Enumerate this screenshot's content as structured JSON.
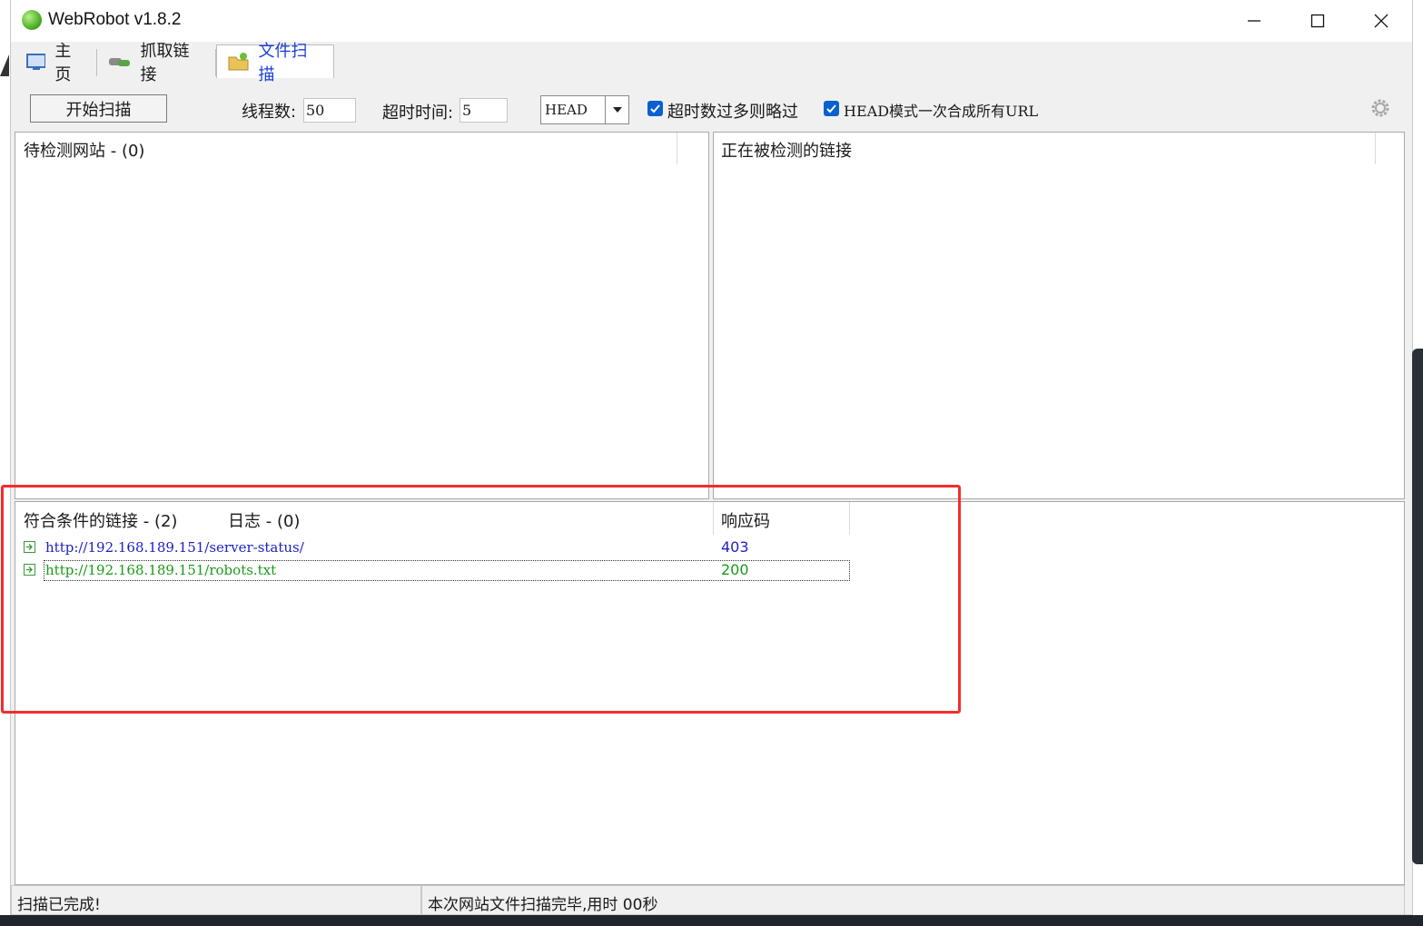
{
  "window": {
    "title": "WebRobot v1.8.2"
  },
  "tabs": [
    {
      "label": "主页"
    },
    {
      "label": "抓取链接"
    },
    {
      "label": "文件扫描"
    }
  ],
  "toolbar": {
    "start_button": "开始扫描",
    "threads_label": "线程数:",
    "threads_value": "50",
    "timeout_label": "超时时间:",
    "timeout_value": "5",
    "method_value": "HEAD",
    "skip_timeout_label": "超时数过多则略过",
    "skip_timeout_checked": true,
    "head_combine_label": "HEAD模式一次合成所有URL",
    "head_combine_checked": true
  },
  "pending_panel": {
    "header": "待检测网站 - (0)"
  },
  "checking_panel": {
    "header": "正在被检测的链接"
  },
  "result_panel": {
    "header": "符合条件的链接 - (2)",
    "log_tab": "日志 - (0)",
    "code_header": "响应码",
    "rows": [
      {
        "url": "http://192.168.189.151/server-status/",
        "code": "403",
        "color": "#1f22c4"
      },
      {
        "url": "http://192.168.189.151/robots.txt",
        "code": "200",
        "color": "#1a9a1a"
      }
    ]
  },
  "status": {
    "left": "扫描已完成!",
    "right": "本次网站文件扫描完毕,用时 00秒"
  },
  "colors": {
    "annotation": "#f32d2d",
    "active_tab": "#1a3fd6",
    "checkbox": "#0a5fd1"
  }
}
